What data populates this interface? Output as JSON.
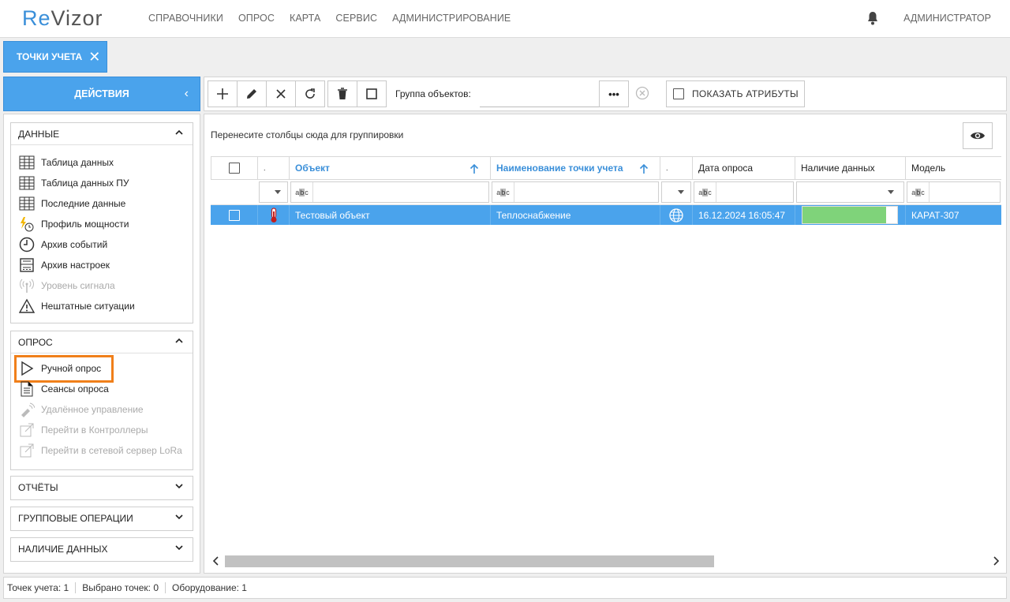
{
  "header": {
    "logo_re": "Re",
    "logo_rest": "Vizor",
    "nav": [
      "СПРАВОЧНИКИ",
      "ОПРОС",
      "КАРТА",
      "СЕРВИС",
      "АДМИНИСТРИРОВАНИЕ"
    ],
    "user": "АДМИНИСТРАТОР"
  },
  "tab": {
    "label": "ТОЧКИ УЧЕТА",
    "close": "✕"
  },
  "actions": {
    "label": "ДЕЙСТВИЯ"
  },
  "left": {
    "data_section": {
      "title": "ДАННЫЕ",
      "items": [
        "Таблица данных",
        "Таблица данных ПУ",
        "Последние данные",
        "Профиль мощности",
        "Архив событий",
        "Архив настроек",
        "Уровень сигнала",
        "Нештатные ситуации"
      ]
    },
    "poll_section": {
      "title": "ОПРОС",
      "items": [
        "Ручной опрос",
        "Сеансы опроса",
        "Удалённое управление",
        "Перейти в Контроллеры",
        "Перейти в сетевой сервер LoRa"
      ]
    },
    "reports": "ОТЧЁТЫ",
    "group_ops": "ГРУППОВЫЕ ОПЕРАЦИИ",
    "data_presence": "НАЛИЧИЕ ДАННЫХ"
  },
  "toolbar": {
    "group_label": "Группа объектов:",
    "dots": "•••",
    "show_attrs": "ПОКАЗАТЬ АТРИБУТЫ"
  },
  "main": {
    "group_hint": "Перенесите столбцы сюда для группировки",
    "columns": [
      ".",
      "Объект",
      "Наименование точки учета",
      ".",
      "Дата опроса",
      "Наличие данных",
      "Модель"
    ],
    "filter_abc": "abc",
    "row": {
      "object": "Тестовый объект",
      "point_name": "Теплоснабжение",
      "poll_date": "16.12.2024 16:05:47",
      "data_presence_fill": 0.88,
      "model": "КАРАТ-307"
    }
  },
  "status": {
    "points": "Точек учета: 1",
    "selected": "Выбрано точек: 0",
    "equipment": "Оборудование: 1"
  },
  "colors": {
    "accent": "#4aa3ec",
    "highlight": "#f07f1a",
    "presence": "#7fd37a"
  }
}
